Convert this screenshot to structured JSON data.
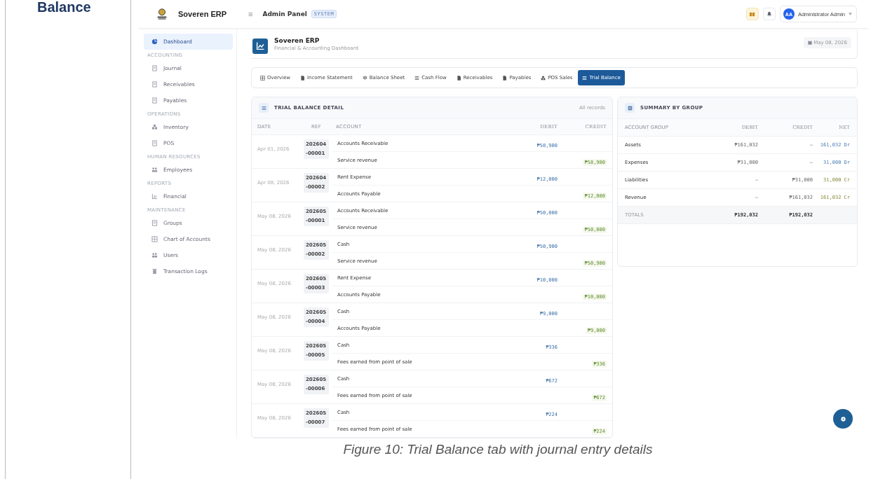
{
  "document": {
    "heading": "Balance",
    "caption": "Figure 10: Trial Balance tab with journal entry details"
  },
  "topbar": {
    "brand": "Soveren ERP",
    "menu_glyph": "≡",
    "title": "Admin Panel",
    "badge": "SYSTEM",
    "user": {
      "initials": "AA",
      "name": "Administrator Admin"
    }
  },
  "sidebar": {
    "items": [
      {
        "kind": "item",
        "label": "Dashboard",
        "selected": true
      },
      {
        "kind": "section",
        "label": "ACCOUNTING"
      },
      {
        "kind": "item",
        "label": "Journal",
        "selected": false
      },
      {
        "kind": "item",
        "label": "Receivables",
        "selected": false
      },
      {
        "kind": "item",
        "label": "Payables",
        "selected": false
      },
      {
        "kind": "section",
        "label": "OPERATIONS"
      },
      {
        "kind": "item",
        "label": "Inventory",
        "selected": false
      },
      {
        "kind": "item",
        "label": "POS",
        "selected": false
      },
      {
        "kind": "section",
        "label": "HUMAN RESOURCES"
      },
      {
        "kind": "item",
        "label": "Employees",
        "selected": false
      },
      {
        "kind": "section",
        "label": "REPORTS"
      },
      {
        "kind": "item",
        "label": "Financial",
        "selected": false
      },
      {
        "kind": "section",
        "label": "MAINTENANCE"
      },
      {
        "kind": "item",
        "label": "Groups",
        "selected": false
      },
      {
        "kind": "item",
        "label": "Chart of Accounts",
        "selected": false
      },
      {
        "kind": "item",
        "label": "Users",
        "selected": false
      },
      {
        "kind": "item",
        "label": "Transaction Logs",
        "selected": false
      }
    ]
  },
  "header": {
    "title": "Soveren ERP",
    "subtitle": "Financial & Accounting Dashboard",
    "date": "May 08, 2026"
  },
  "tabs": [
    {
      "label": "Overview",
      "selected": false
    },
    {
      "label": "Income Statement",
      "selected": false
    },
    {
      "label": "Balance Sheet",
      "selected": false
    },
    {
      "label": "Cash Flow",
      "selected": false
    },
    {
      "label": "Receivables",
      "selected": false
    },
    {
      "label": "Payables",
      "selected": false
    },
    {
      "label": "POS Sales",
      "selected": false
    },
    {
      "label": "Trial Balance",
      "selected": true
    }
  ],
  "detail": {
    "title": "TRIAL BALANCE DETAIL",
    "note": "All records",
    "columns": [
      "DATE",
      "REF",
      "ACCOUNT",
      "DEBIT",
      "CREDIT"
    ],
    "entries": [
      {
        "date": "Apr 01, 2026",
        "ref": "202604-00001",
        "lines": [
          {
            "account": "Accounts Receivable",
            "amount": "₱58,900",
            "credit_side": false
          },
          {
            "account": "Service revenue",
            "amount": "₱58,900",
            "credit_side": true
          }
        ]
      },
      {
        "date": "Apr 08, 2026",
        "ref": "202604-00002",
        "lines": [
          {
            "account": "Rent Expense",
            "amount": "₱12,000",
            "credit_side": false
          },
          {
            "account": "Accounts Payable",
            "amount": "₱12,000",
            "credit_side": true
          }
        ]
      },
      {
        "date": "May 08, 2026",
        "ref": "202605-00001",
        "lines": [
          {
            "account": "Accounts Receivable",
            "amount": "₱50,000",
            "credit_side": false
          },
          {
            "account": "Service revenue",
            "amount": "₱50,000",
            "credit_side": true
          }
        ]
      },
      {
        "date": "May 08, 2026",
        "ref": "202605-00002",
        "lines": [
          {
            "account": "Cash",
            "amount": "₱50,900",
            "credit_side": false
          },
          {
            "account": "Service revenue",
            "amount": "₱50,900",
            "credit_side": true
          }
        ]
      },
      {
        "date": "May 08, 2026",
        "ref": "202605-00003",
        "lines": [
          {
            "account": "Rent Expense",
            "amount": "₱10,000",
            "credit_side": false
          },
          {
            "account": "Accounts Payable",
            "amount": "₱10,000",
            "credit_side": true
          }
        ]
      },
      {
        "date": "May 08, 2026",
        "ref": "202605-00004",
        "lines": [
          {
            "account": "Cash",
            "amount": "₱9,000",
            "credit_side": false
          },
          {
            "account": "Accounts Payable",
            "amount": "₱9,000",
            "credit_side": true
          }
        ]
      },
      {
        "date": "May 08, 2026",
        "ref": "202605-00005",
        "lines": [
          {
            "account": "Cash",
            "amount": "₱336",
            "credit_side": false
          },
          {
            "account": "Fees earned from point of sale",
            "amount": "₱336",
            "credit_side": true
          }
        ]
      },
      {
        "date": "May 08, 2026",
        "ref": "202605-00006",
        "lines": [
          {
            "account": "Cash",
            "amount": "₱672",
            "credit_side": false
          },
          {
            "account": "Fees earned from point of sale",
            "amount": "₱672",
            "credit_side": true
          }
        ]
      },
      {
        "date": "May 08, 2026",
        "ref": "202605-00007",
        "lines": [
          {
            "account": "Cash",
            "amount": "₱224",
            "credit_side": false
          },
          {
            "account": "Fees earned from point of sale",
            "amount": "₱224",
            "credit_side": true
          }
        ]
      }
    ]
  },
  "summary": {
    "title": "SUMMARY BY GROUP",
    "columns": [
      "ACCOUNT GROUP",
      "DEBIT",
      "CREDIT",
      "NET"
    ],
    "rows": [
      {
        "group": "Assets",
        "debit": "₱161,032",
        "credit": "—",
        "net": "161,032 Dr",
        "net_credit": false
      },
      {
        "group": "Expenses",
        "debit": "₱31,000",
        "credit": "—",
        "net": "31,000 Dr",
        "net_credit": false
      },
      {
        "group": "Liabilities",
        "debit": "—",
        "credit": "₱31,000",
        "net": "31,000 Cr",
        "net_credit": true
      },
      {
        "group": "Revenue",
        "debit": "—",
        "credit": "₱161,032",
        "net": "161,032 Cr",
        "net_credit": true
      }
    ],
    "totals": {
      "label": "TOTALS",
      "debit": "₱192,032",
      "credit": "₱192,032"
    }
  }
}
